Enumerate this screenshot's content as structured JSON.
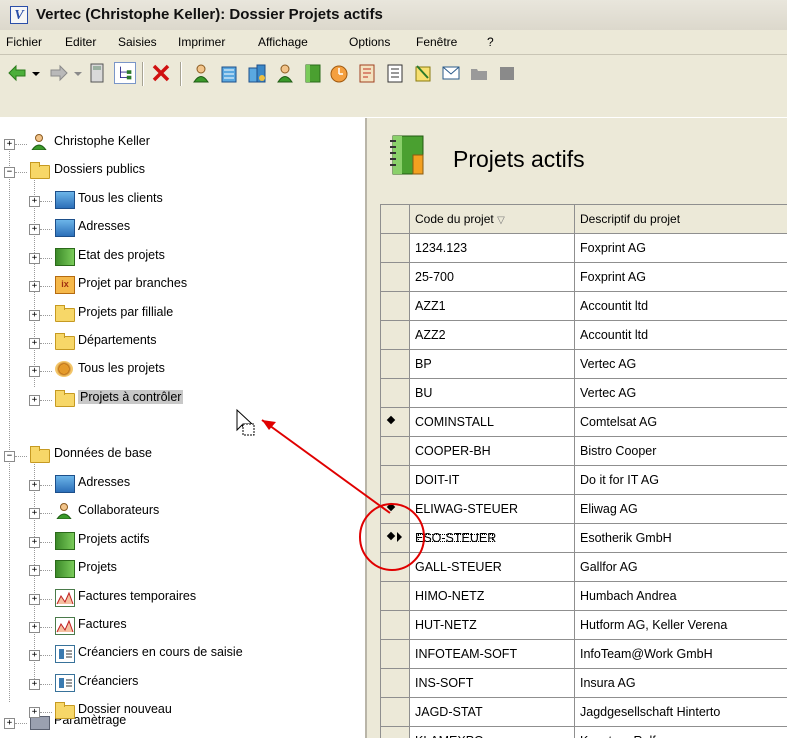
{
  "window": {
    "title": "Vertec (Christophe Keller): Dossier Projets actifs"
  },
  "menu": [
    "Fichier",
    "Editer",
    "Saisies",
    "Imprimer",
    "Affichage",
    "Options",
    "Fenêtre",
    "?"
  ],
  "tree": {
    "user": "Christophe Keller",
    "public_folder": "Dossiers publics",
    "public_items": [
      {
        "label": "Tous les clients",
        "icon": "building-icon"
      },
      {
        "label": "Adresses",
        "icon": "building-icon"
      },
      {
        "label": "Etat des projets",
        "icon": "book-icon"
      },
      {
        "label": "Projet par branches",
        "icon": "expression-icon"
      },
      {
        "label": "Projets par filliale",
        "icon": "folder-icon"
      },
      {
        "label": "Départements",
        "icon": "folder-icon"
      },
      {
        "label": "Tous les projets",
        "icon": "gear-icon"
      },
      {
        "label": "Projets à contrôler",
        "icon": "folder-icon"
      }
    ],
    "base_folder": "Données de base",
    "base_items": [
      {
        "label": "Adresses",
        "icon": "building-icon"
      },
      {
        "label": "Collaborateurs",
        "icon": "person-icon"
      },
      {
        "label": "Projets actifs",
        "icon": "book-icon"
      },
      {
        "label": "Projets",
        "icon": "book-icon"
      },
      {
        "label": "Factures temporaires",
        "icon": "invoice-icon"
      },
      {
        "label": "Factures",
        "icon": "invoice-icon"
      },
      {
        "label": "Créanciers en cours de saisie",
        "icon": "creditor-icon"
      },
      {
        "label": "Créanciers",
        "icon": "creditor-icon"
      },
      {
        "label": "Dossier nouveau",
        "icon": "folder-icon"
      }
    ],
    "settings": "Paramètrage"
  },
  "page": {
    "title": "Projets actifs"
  },
  "grid": {
    "columns": [
      "Code du projet",
      "Descriptif du projet"
    ],
    "sort_indicator": "▽",
    "rows": [
      {
        "code": "1234.123",
        "desc": "Foxprint AG",
        "mark": ""
      },
      {
        "code": "25-700",
        "desc": "Foxprint AG",
        "mark": ""
      },
      {
        "code": "AZZ1",
        "desc": "Accountit ltd",
        "mark": ""
      },
      {
        "code": "AZZ2",
        "desc": "Accountit ltd",
        "mark": ""
      },
      {
        "code": "BP",
        "desc": "Vertec AG",
        "mark": ""
      },
      {
        "code": "BU",
        "desc": "Vertec AG",
        "mark": ""
      },
      {
        "code": "COMINSTALL",
        "desc": "Comtelsat AG",
        "mark": "dot"
      },
      {
        "code": "COOPER-BH",
        "desc": "Bistro Cooper",
        "mark": ""
      },
      {
        "code": "DOIT-IT",
        "desc": "Do it for IT AG",
        "mark": ""
      },
      {
        "code": "ELIWAG-STEUER",
        "desc": "Eliwag AG",
        "mark": "dot"
      },
      {
        "code": "ESO-STEUER",
        "desc": "Esotherik GmbH",
        "mark": "current"
      },
      {
        "code": "GALL-STEUER",
        "desc": "Gallfor AG",
        "mark": ""
      },
      {
        "code": "HIMO-NETZ",
        "desc": "Humbach Andrea",
        "mark": ""
      },
      {
        "code": "HUT-NETZ",
        "desc": "Hutform AG, Keller Verena",
        "mark": ""
      },
      {
        "code": "INFOTEAM-SOFT",
        "desc": "InfoTeam@Work GmbH",
        "mark": ""
      },
      {
        "code": "INS-SOFT",
        "desc": "Insura AG",
        "mark": ""
      },
      {
        "code": "JAGD-STAT",
        "desc": "Jagdgesellschaft Hinterto",
        "mark": ""
      },
      {
        "code": "KLAMEXPO",
        "desc": "Kaestner Rolf",
        "mark": ""
      }
    ]
  },
  "colors": {
    "annotation": "#e00000",
    "chrome": "#ece9d8",
    "selection": "#c8c8c8"
  }
}
